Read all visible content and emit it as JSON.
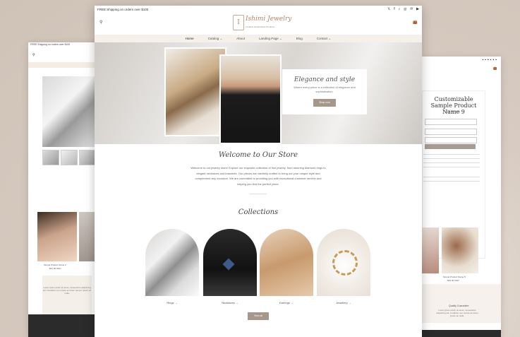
{
  "announcement": "FREE Shipping on orders over $100",
  "social_icons": [
    "twitter-icon",
    "facebook-icon",
    "tiktok-icon",
    "instagram-icon",
    "pinterest-icon",
    "youtube-icon"
  ],
  "brand": {
    "name": "Ishimi Jewelry",
    "tagline": "Creative Handcrafted Products"
  },
  "nav": [
    "Home",
    "Catalog ⌄",
    "About",
    "Landing Page ⌄",
    "Blog",
    "Contact ⌄"
  ],
  "hero": {
    "heading": "Elegance and style",
    "text": "Where every piece is a reflection of elegance and sophistication.",
    "button": "Shop now"
  },
  "welcome": {
    "heading": "Welcome to Our Store",
    "text": "Welcome to our jewelry store! Explore our exquisite collection of fine jewelry, from stunning diamond rings to elegant necklaces and bracelets. Our pieces are carefully crafted to bring out your unique style and complement any occasion. We are committed to providing you with exceptional customer service and helping you find the perfect piece."
  },
  "collections": {
    "heading": "Collections",
    "items": [
      {
        "label": "Rings →"
      },
      {
        "label": "Necklaces →"
      },
      {
        "label": "Earrings →"
      },
      {
        "label": "Jewellery →"
      }
    ],
    "view_all": "View all"
  },
  "left_preview": {
    "announcement": "FREE Shipping on orders over $100",
    "product_caption": "Simple Product Name 2",
    "product_price": "$21.00 SGD",
    "note": "Lorem ipsum dolor sit amet, consectetur adipiscing elit. Curabitur nec ornare ac lorem tempor ipsum ac nulla."
  },
  "right_preview": {
    "product_title": "Customizable Sample Product Name 9",
    "price": "$18.00 SGD",
    "button": "Add to cart",
    "caption": "Simple Product Name 5",
    "caption_price": "$15.00 SGD",
    "footer_heading": "Quality Guarantee",
    "footer_text": "Lorem ipsum dolor sit amet, consectetur adipiscing elit. Curabitur nec ornare ac lorem ipsum ac nulla."
  }
}
